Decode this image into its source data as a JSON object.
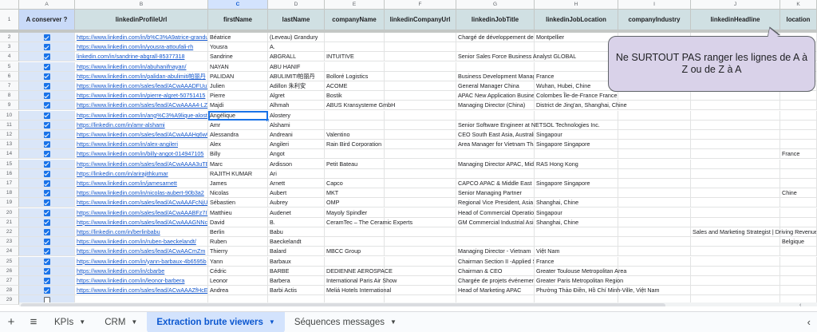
{
  "columns": [
    "A",
    "B",
    "C",
    "D",
    "E",
    "F",
    "G",
    "H",
    "I",
    "J",
    "K"
  ],
  "selected_column": "C",
  "header_row_number": "1",
  "headers": [
    "A conserver ?",
    "linkedinProfileUrl",
    "firstName",
    "lastName",
    "companyName",
    "linkedinCompanyUrl",
    "linkedinJobTitle",
    "linkedinJobLocation",
    "companyIndustry",
    "linkedinHeadline",
    "location"
  ],
  "rows": [
    {
      "n": "2",
      "keep": true,
      "url": "https://www.linkedin.com/in/b%C3%A9atrice-grandury",
      "first": "Béatrice",
      "last": "(Leveau) Grandury",
      "company": "",
      "job": "Chargé de développement des",
      "jobloc": "Montpellier",
      "headline": "",
      "location": ""
    },
    {
      "n": "3",
      "keep": true,
      "url": "https://www.linkedin.com/in/yousra-attoufali-rh",
      "first": "Yousra",
      "last": "A.",
      "company": "",
      "job": "",
      "jobloc": "",
      "headline": "",
      "location": ""
    },
    {
      "n": "4",
      "keep": true,
      "url": "linkedin.com/in/sandrine-abgrall-85377318",
      "first": "Sandrine",
      "last": "ABGRALL",
      "company": "INTUITIVE",
      "job": "Senior Sales Force Business Analyst GLOBAL",
      "jobloc": "",
      "headline": "",
      "location": ""
    },
    {
      "n": "5",
      "keep": true,
      "url": "https://www.linkedin.com/in/abuhanifnayan/",
      "first": "NAYAN",
      "last": "ABU HANIF",
      "company": "",
      "job": "",
      "jobloc": "",
      "headline": "",
      "location": ""
    },
    {
      "n": "6",
      "keep": true,
      "url": "https://www.linkedin.com/in/palidan-abulimiti帕丽丹",
      "first": "PALIDAN",
      "last": "ABULIMITI帕丽丹",
      "company": "Bolloré Logistics",
      "job": "Business Development Manager",
      "jobloc": "France",
      "headline": "",
      "location": ""
    },
    {
      "n": "7",
      "keep": true,
      "url": "https://www.linkedin.com/sales/lead/ACwAAADFUuY",
      "first": "Julien",
      "last": "Adillon 朱利安",
      "company": "ACOME",
      "job": "General Manager China",
      "jobloc": "Wuhan, Hubei, Chine",
      "headline": "",
      "location": ""
    },
    {
      "n": "8",
      "keep": true,
      "url": "https://www.linkedin.com/in/pierre-algret-50751415",
      "first": "Pierre",
      "last": "Algret",
      "company": "Bostik",
      "job": "APAC New Application Business",
      "jobloc": "Colombes Île-de-France France",
      "headline": "",
      "location": ""
    },
    {
      "n": "9",
      "keep": true,
      "url": "https://www.linkedin.com/sales/lead/ACwAAAA4-LZ8I",
      "first": "Majdi",
      "last": "Alhmah",
      "company": "ABUS Kransysteme GmbH",
      "job": "Managing Director (China)",
      "jobloc": "District de Jing'an, Shanghai, Chine",
      "headline": "",
      "location": ""
    },
    {
      "n": "10",
      "keep": true,
      "url": "https://www.linkedin.com/in/ang%C3%A9lique-alostery",
      "first": "Angélique",
      "last": "Alostery",
      "company": "",
      "job": "",
      "jobloc": "",
      "headline": "",
      "location": ""
    },
    {
      "n": "11",
      "keep": true,
      "url": "https://linkedin.com/in/amr-alshami",
      "first": "Amr",
      "last": "Alshami",
      "company": "",
      "job": "Senior Software Engineer at NETSOL Technologies Inc.",
      "jobloc": "",
      "headline": "",
      "location": ""
    },
    {
      "n": "12",
      "keep": true,
      "url": "https://www.linkedin.com/sales/lead/ACwAAAHq6wU",
      "first": "Alessandra",
      "last": "Andreani",
      "company": "Valentino",
      "job": "CEO South East Asia, Australia",
      "jobloc": "Singapour",
      "headline": "",
      "location": ""
    },
    {
      "n": "13",
      "keep": true,
      "url": "https://www.linkedin.com/in/alex-angileri",
      "first": "Alex",
      "last": "Angileri",
      "company": "Rain Bird Corporation",
      "job": "Area Manager for Vietnam Tha",
      "jobloc": "Singapore Singapore",
      "headline": "",
      "location": ""
    },
    {
      "n": "14",
      "keep": true,
      "url": "https://www.linkedin.com/in/billy-angot-014947105",
      "first": "Billy",
      "last": "Angot",
      "company": "",
      "job": "",
      "jobloc": "",
      "headline": "",
      "location": "France"
    },
    {
      "n": "15",
      "keep": true,
      "url": "https://www.linkedin.com/sales/lead/ACwAAAA3uTE",
      "first": "Marc",
      "last": "Ardisson",
      "company": "Petit Bateau",
      "job": "Managing Director APAC, Midd",
      "jobloc": "RAS Hong Kong",
      "headline": "",
      "location": ""
    },
    {
      "n": "16",
      "keep": true,
      "url": "https://linkedin.com/in/arirajithkumar",
      "first": "RAJITH KUMAR",
      "last": "Ari",
      "company": "",
      "job": "",
      "jobloc": "",
      "headline": "",
      "location": ""
    },
    {
      "n": "17",
      "keep": true,
      "url": "https://www.linkedin.com/in/jamesarnett",
      "first": "James",
      "last": "Arnett",
      "company": "Capco",
      "job": "CAPCO APAC & Middle East Ma",
      "jobloc": "Singapore Singapore",
      "headline": "",
      "location": ""
    },
    {
      "n": "18",
      "keep": true,
      "url": "https://www.linkedin.com/in/nicolas-aubert-90b3a2",
      "first": "Nicolas",
      "last": "Aubert",
      "company": "MKT",
      "job": "Senior Managing Partner",
      "jobloc": "",
      "headline": "",
      "location": "Chine"
    },
    {
      "n": "19",
      "keep": true,
      "url": "https://www.linkedin.com/sales/lead/ACwAAAFcNjU",
      "first": "Sébastien",
      "last": "Aubrey",
      "company": "OMP",
      "job": "Regional Vice President, Asia",
      "jobloc": "Shanghai, Chine",
      "headline": "",
      "location": ""
    },
    {
      "n": "20",
      "keep": true,
      "url": "https://www.linkedin.com/sales/lead/ACwAAABFz7IYE",
      "first": "Matthieu",
      "last": "Audenet",
      "company": "Mayoly Spindler",
      "job": "Head of Commercial Operation",
      "jobloc": "Singapour",
      "headline": "",
      "location": ""
    },
    {
      "n": "21",
      "keep": true,
      "url": "https://www.linkedin.com/sales/lead/ACwAAAGNNc",
      "first": "David",
      "last": "B.",
      "company": "CeramTec – The Ceramic Experts",
      "job": "GM Commercial Industrial Asia",
      "jobloc": "Shanghai, Chine",
      "headline": "",
      "location": ""
    },
    {
      "n": "22",
      "keep": true,
      "url": "https://linkedin.com/in/berlinbabu",
      "first": "Berlin",
      "last": "Babu",
      "company": "",
      "job": "",
      "jobloc": "",
      "headline": "Sales and Marketing Strategist | Driving Revenue",
      "location": ""
    },
    {
      "n": "23",
      "keep": true,
      "url": "https://www.linkedin.com/in/ruben-baeckelandt/",
      "first": "Ruben",
      "last": "Baeckelandt",
      "company": "",
      "job": "",
      "jobloc": "",
      "headline": "",
      "location": "Belgique"
    },
    {
      "n": "24",
      "keep": true,
      "url": "https://www.linkedin.com/sales/lead/ACwAACmZm",
      "first": "Thierry",
      "last": "Balard",
      "company": "MBCC Group",
      "job": "Managing Director - Vietnam",
      "jobloc": "Việt Nam",
      "headline": "",
      "location": ""
    },
    {
      "n": "25",
      "keep": true,
      "url": "https://www.linkedin.com/in/yann-barbaux-4b6595b",
      "first": "Yann",
      "last": "Barbaux",
      "company": "",
      "job": "Chairman Section II -Applied Sc",
      "jobloc": "France",
      "headline": "",
      "location": ""
    },
    {
      "n": "26",
      "keep": true,
      "url": "https://www.linkedin.com/in/cbarbe",
      "first": "Cédric",
      "last": "BARBE",
      "company": "DEDIENNE AEROSPACE",
      "job": "Chairman & CEO",
      "jobloc": "Greater Toulouse Metropolitan Area",
      "headline": "",
      "location": ""
    },
    {
      "n": "27",
      "keep": true,
      "url": "https://www.linkedin.com/in/leonor-barbera",
      "first": "Leonor",
      "last": "Barbera",
      "company": "International Paris Air Show",
      "job": "Chargée de projets événement",
      "jobloc": "Greater Paris Metropolitan Region",
      "headline": "",
      "location": ""
    },
    {
      "n": "28",
      "keep": true,
      "url": "https://www.linkedin.com/sales/lead/ACwAAAZfHcE",
      "first": "Andrea",
      "last": "Barbi Actis",
      "company": "Meliá Hotels International",
      "job": "Head of Marketing APAC",
      "jobloc": "Phường Thảo Điền, Hồ Chí Minh-Ville, Việt Nam",
      "headline": "",
      "location": ""
    },
    {
      "n": "29",
      "keep": false,
      "url": "",
      "first": "",
      "last": "",
      "company": "",
      "job": "",
      "jobloc": "",
      "headline": "",
      "location": ""
    }
  ],
  "note": "Ne SURTOUT PAS ranger les lignes de A à Z ou de Z à A",
  "tabs": [
    {
      "label": "KPIs",
      "active": false
    },
    {
      "label": "CRM",
      "active": false
    },
    {
      "label": "Extraction brute viewers",
      "active": true
    },
    {
      "label": "Séquences messages",
      "active": false
    }
  ],
  "icons": {
    "add_sheet": "plus-icon",
    "all_sheets": "menu-icon",
    "tab_menu": "caret-down-icon",
    "nav": "chevron-left-icon"
  },
  "colors": {
    "header_fill": "#d0e0e3",
    "checkbox_col": "#dae6f8",
    "note_fill": "#d9d2e9",
    "link": "#1155cc",
    "accent": "#1a73e8",
    "active_tab": "#d3e3fd"
  }
}
